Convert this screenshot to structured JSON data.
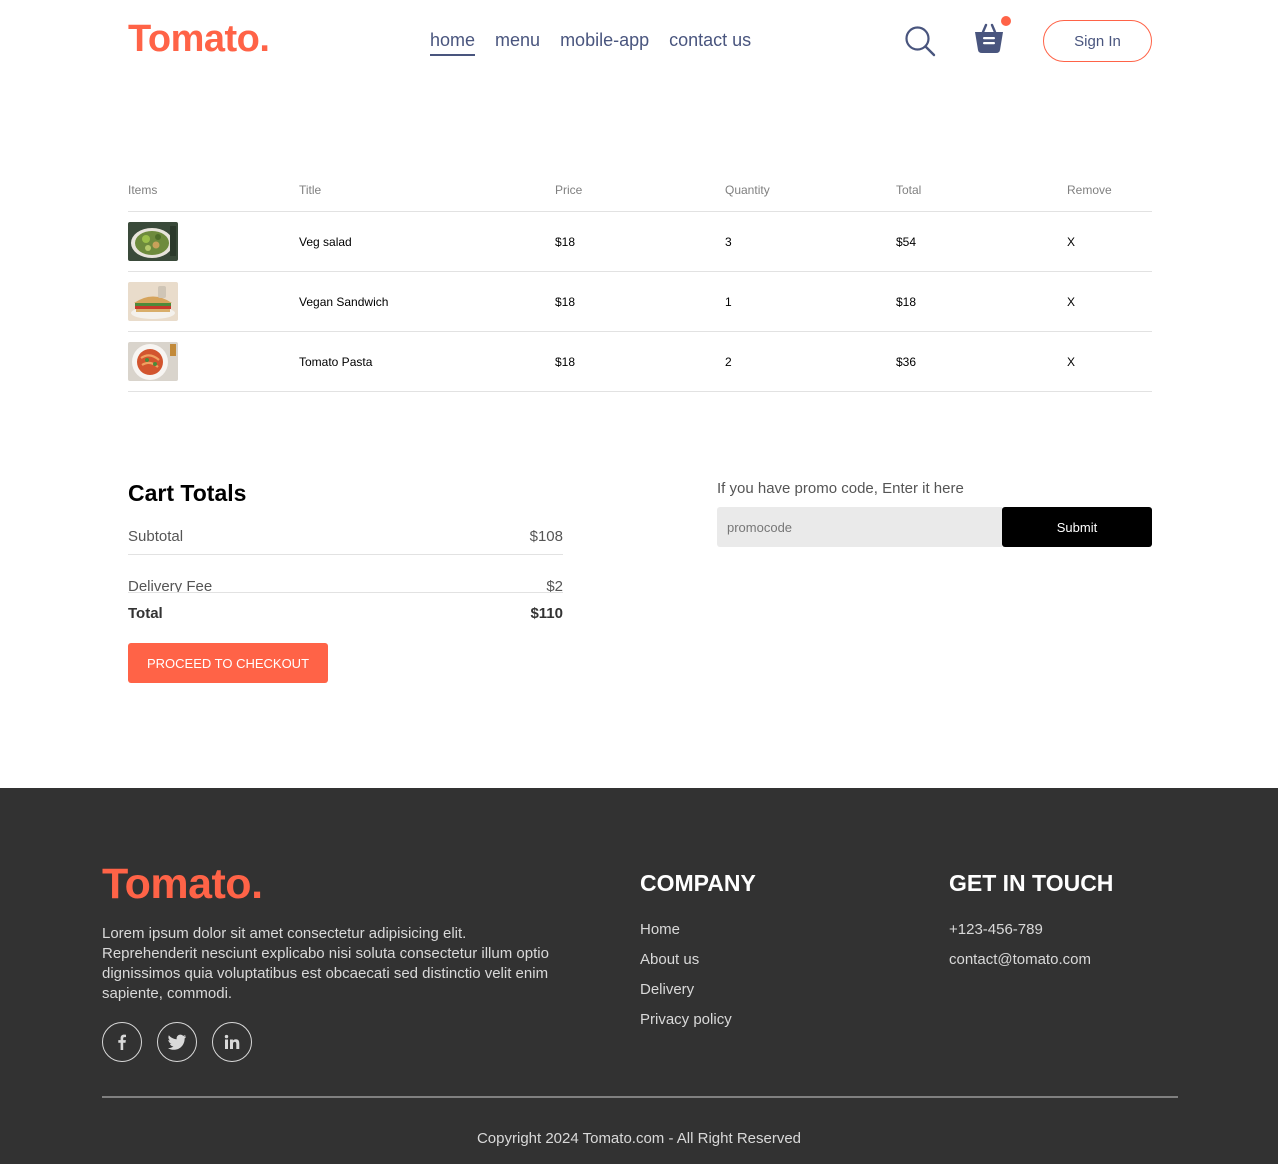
{
  "navbar": {
    "logo": "Tomato.",
    "links": [
      "home",
      "menu",
      "mobile-app",
      "contact us"
    ],
    "active_link": "home",
    "sign_in": "Sign In"
  },
  "cart": {
    "headers": [
      "Items",
      "Title",
      "Price",
      "Quantity",
      "Total",
      "Remove"
    ],
    "items": [
      {
        "title": "Veg salad",
        "price": "$18",
        "quantity": "3",
        "total": "$54",
        "remove": "X"
      },
      {
        "title": "Vegan Sandwich",
        "price": "$18",
        "quantity": "1",
        "total": "$18",
        "remove": "X"
      },
      {
        "title": "Tomato Pasta",
        "price": "$18",
        "quantity": "2",
        "total": "$36",
        "remove": "X"
      }
    ]
  },
  "totals": {
    "title": "Cart Totals",
    "subtotal_label": "Subtotal",
    "subtotal_value": "$108",
    "delivery_label": "Delivery Fee",
    "delivery_value": "$2",
    "total_label": "Total",
    "total_value": "$110",
    "checkout": "PROCEED TO CHECKOUT"
  },
  "promo": {
    "label": "If you have promo code, Enter it here",
    "placeholder": "promocode",
    "submit": "Submit"
  },
  "footer": {
    "logo": "Tomato.",
    "description": "Lorem ipsum dolor sit amet consectetur adipisicing elit. Reprehenderit nesciunt explicabo nisi soluta consectetur illum optio dignissimos quia voluptatibus est obcaecati sed distinctio velit enim sapiente, commodi.",
    "company_title": "COMPANY",
    "company_links": [
      "Home",
      "About us",
      "Delivery",
      "Privacy policy"
    ],
    "contact_title": "GET IN TOUCH",
    "contact_items": [
      "+123-456-789",
      "contact@tomato.com"
    ],
    "copyright": "Copyright 2024 Tomato.com - All Right Reserved"
  },
  "colors": {
    "brand": "#ff6347",
    "nav_text": "#49557e",
    "footer_bg": "#323232"
  }
}
